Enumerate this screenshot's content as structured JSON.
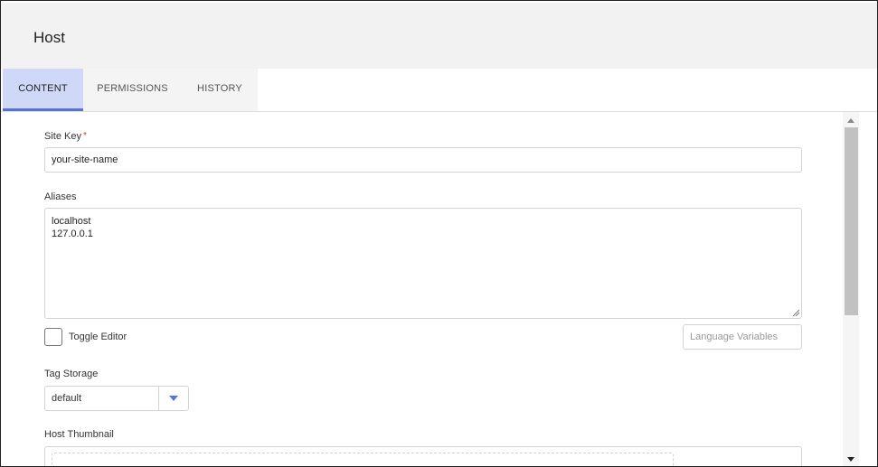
{
  "header": {
    "title": "Host"
  },
  "tabs": [
    {
      "label": "CONTENT",
      "active": true
    },
    {
      "label": "PERMISSIONS",
      "active": false
    },
    {
      "label": "HISTORY",
      "active": false
    }
  ],
  "form": {
    "site_key": {
      "label": "Site Key",
      "required_mark": "*",
      "value": "your-site-name"
    },
    "aliases": {
      "label": "Aliases",
      "lines": [
        "localhost",
        "127.0.0.1"
      ]
    },
    "toggle_editor": {
      "label": "Toggle Editor",
      "checked": false
    },
    "language_variables": {
      "placeholder": "Language Variables"
    },
    "tag_storage": {
      "label": "Tag Storage",
      "value": "default"
    },
    "host_thumbnail": {
      "label": "Host Thumbnail"
    }
  },
  "colors": {
    "accent": "#5a72d8",
    "active_tab_bg": "#cfd8f7",
    "header_bg": "#f2f2f2",
    "required": "#dd3333"
  },
  "icons": {
    "dropdown": "caret-down-icon",
    "scroll_up": "arrow-up-icon",
    "scroll_down": "arrow-down-icon"
  }
}
